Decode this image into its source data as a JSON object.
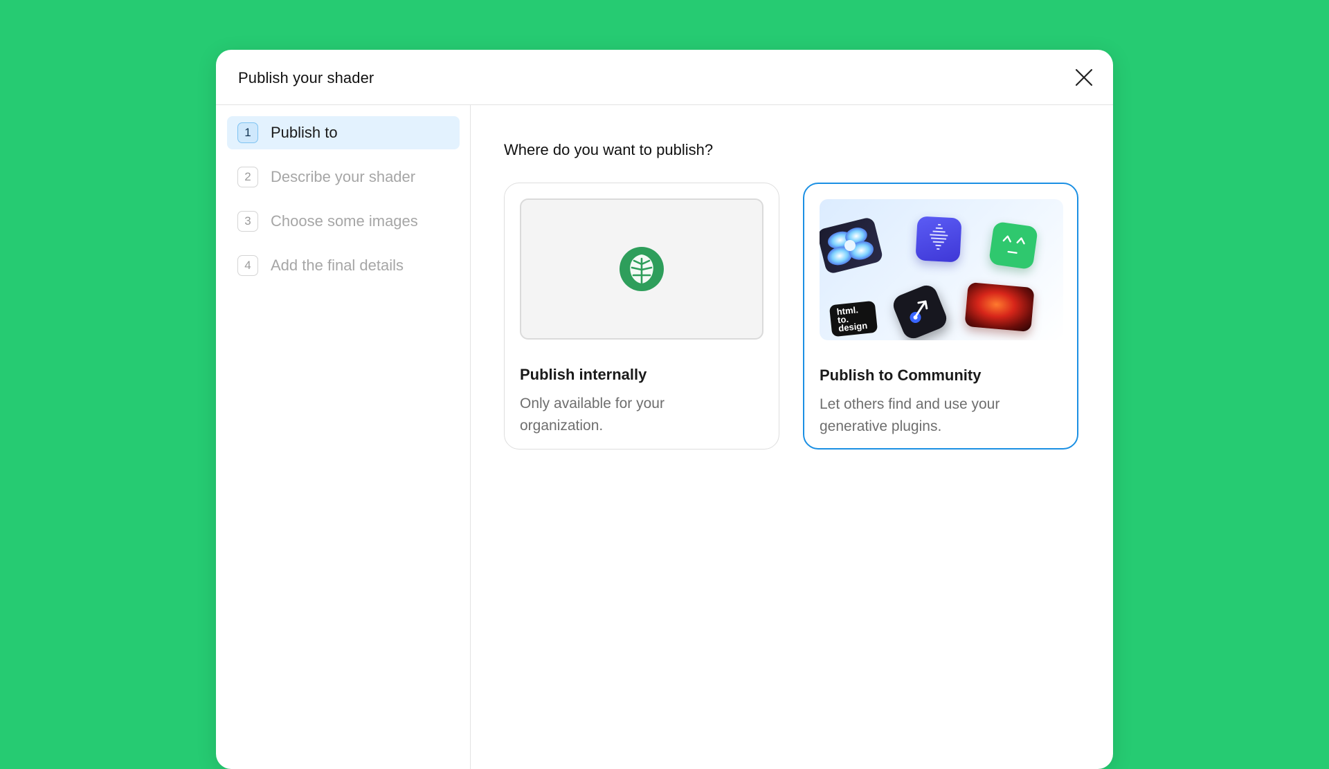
{
  "dialog": {
    "title": "Publish your shader",
    "close_icon": "close-icon"
  },
  "steps": [
    {
      "number": "1",
      "label": "Publish to",
      "active": true
    },
    {
      "number": "2",
      "label": "Describe your shader",
      "active": false
    },
    {
      "number": "3",
      "label": "Choose some images",
      "active": false
    },
    {
      "number": "4",
      "label": "Add the final details",
      "active": false
    }
  ],
  "main": {
    "question": "Where do you want to publish?",
    "options": [
      {
        "title": "Publish internally",
        "description": "Only available for your organization.",
        "icon": "organization-leaf-icon",
        "selected": false
      },
      {
        "title": "Publish to Community",
        "description": "Let others find and use your generative plugins.",
        "icon": "community-plugins-collage",
        "selected": true,
        "tile_texts": [
          "html.",
          "to.",
          "design"
        ]
      }
    ]
  },
  "colors": {
    "background": "#26cb72",
    "accent": "#1a8fe3",
    "active_step_bg": "#e3f2fe",
    "logo_green": "#2e9e5b"
  }
}
